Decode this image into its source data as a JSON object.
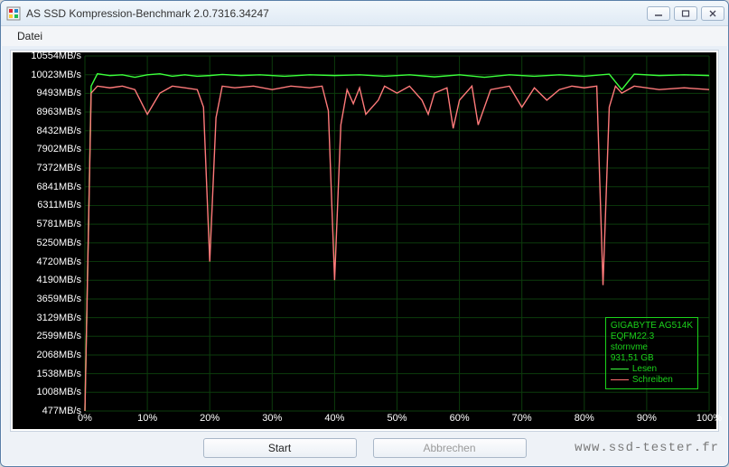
{
  "window": {
    "title": "AS SSD Kompression-Benchmark 2.0.7316.34247"
  },
  "menubar": {
    "items": [
      {
        "label": "Datei"
      }
    ]
  },
  "buttons": {
    "start": "Start",
    "cancel": "Abbrechen"
  },
  "device_info": {
    "line1": "GIGABYTE AG514K",
    "line2": "EQFM22.3",
    "line3": "stornvme",
    "line4": "931,51 GB"
  },
  "legend": {
    "read": "Lesen",
    "write": "Schreiben"
  },
  "watermark": "www.ssd-tester.fr",
  "chart_data": {
    "type": "line",
    "xlabel": "",
    "ylabel": "",
    "x_unit": "%",
    "y_unit": "MB/s",
    "xlim": [
      0,
      100
    ],
    "ylim": [
      477,
      10554
    ],
    "x_ticks": [
      0,
      10,
      20,
      30,
      40,
      50,
      60,
      70,
      80,
      90,
      100
    ],
    "y_ticks": [
      10554,
      10023,
      9493,
      8963,
      8432,
      7902,
      7372,
      6841,
      6311,
      5781,
      5250,
      4720,
      4190,
      3659,
      3129,
      2599,
      2068,
      1538,
      1008,
      477
    ],
    "y_tick_labels": [
      "10554MB/s",
      "10023MB/s",
      "9493MB/s",
      "8963MB/s",
      "8432MB/s",
      "7902MB/s",
      "7372MB/s",
      "6841MB/s",
      "6311MB/s",
      "5781MB/s",
      "5250MB/s",
      "4720MB/s",
      "4190MB/s",
      "3659MB/s",
      "3129MB/s",
      "2599MB/s",
      "2068MB/s",
      "1538MB/s",
      "1008MB/s",
      "477MB/s"
    ],
    "x_tick_labels": [
      "0%",
      "10%",
      "20%",
      "30%",
      "40%",
      "50%",
      "60%",
      "70%",
      "80%",
      "90%",
      "100%"
    ],
    "series": [
      {
        "name": "Lesen",
        "color": "#3cff3c",
        "x": [
          0,
          1,
          2,
          4,
          6,
          8,
          10,
          12,
          14,
          16,
          18,
          20,
          22,
          25,
          28,
          32,
          36,
          40,
          44,
          48,
          52,
          56,
          60,
          64,
          68,
          72,
          76,
          80,
          84,
          86,
          88,
          92,
          96,
          100
        ],
        "values": [
          477,
          9700,
          10050,
          10000,
          10020,
          9950,
          10020,
          10050,
          9980,
          10020,
          9980,
          10000,
          10030,
          10000,
          10020,
          9980,
          10020,
          10000,
          10020,
          9980,
          10020,
          9960,
          10020,
          9950,
          10020,
          9980,
          10020,
          9980,
          10040,
          9600,
          10040,
          10000,
          10020,
          10000
        ]
      },
      {
        "name": "Schreiben",
        "color": "#ff7a7a",
        "x": [
          0,
          1,
          2,
          4,
          6,
          8,
          10,
          12,
          14,
          16,
          18,
          19,
          20,
          21,
          22,
          24,
          27,
          30,
          33,
          36,
          38,
          39,
          40,
          41,
          42,
          43,
          44,
          45,
          47,
          48,
          50,
          52,
          54,
          55,
          56,
          58,
          59,
          60,
          62,
          63,
          65,
          68,
          70,
          72,
          74,
          76,
          78,
          80,
          82,
          83,
          84,
          85,
          86,
          88,
          92,
          96,
          100
        ],
        "values": [
          477,
          9500,
          9700,
          9650,
          9700,
          9600,
          8900,
          9500,
          9700,
          9650,
          9600,
          9100,
          4720,
          8800,
          9700,
          9650,
          9700,
          9600,
          9700,
          9650,
          9700,
          9000,
          4190,
          8600,
          9600,
          9200,
          9650,
          8900,
          9300,
          9700,
          9500,
          9700,
          9300,
          8900,
          9500,
          9650,
          8500,
          9300,
          9700,
          8600,
          9600,
          9700,
          9100,
          9650,
          9300,
          9600,
          9700,
          9650,
          9700,
          4050,
          9100,
          9700,
          9500,
          9700,
          9600,
          9650,
          9600
        ]
      }
    ]
  }
}
